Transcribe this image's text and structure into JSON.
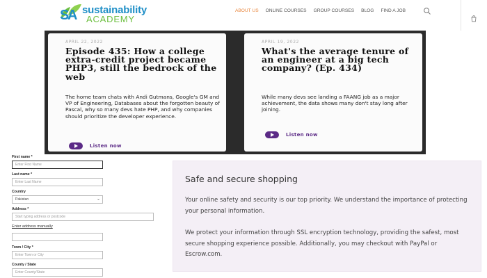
{
  "brand": {
    "line1": "sustainability",
    "line2": "ACADEMY",
    "colors": {
      "blue": "#1f8fc7",
      "green": "#6cbf3f"
    }
  },
  "nav": {
    "items": [
      {
        "label": "ABOUT US",
        "active": true
      },
      {
        "label": "ONLINE COURSES",
        "active": false
      },
      {
        "label": "GROUP COURSES",
        "active": false
      },
      {
        "label": "BLOG",
        "active": false
      },
      {
        "label": "FIND A JOB",
        "active": false
      }
    ],
    "accent": "#e8843a",
    "search_icon": "search-icon",
    "cart_icon": "cart-icon"
  },
  "podcast": {
    "cards": [
      {
        "date": "APRIL 22, 2022",
        "title": "Episode 435: How a college extra-credit project became PHP3, still the bedrock of the web",
        "desc": "The home team chats with Andi Gutmans, Google's GM and VP of Engineering, Databases about the forgotten beauty of Pascal, why so many devs hate PHP, and why companies should prioritize the developer experience.",
        "listen": "Listen now"
      },
      {
        "date": "APRIL 19, 2022",
        "title": "What's the average tenure of an engineer at a big tech company? (Ep. 434)",
        "desc": "While many devs see landing a FAANG job as a major achievement, the data shows many don't stay long after joining.",
        "listen": "Listen now"
      }
    ],
    "accent": "#5b2a86"
  },
  "form": {
    "first_name": {
      "label": "First name *",
      "placeholder": "Enter First Name"
    },
    "last_name": {
      "label": "Last name *",
      "placeholder": "Enter Last Name"
    },
    "country": {
      "label": "Country",
      "value": "Pakistan"
    },
    "address": {
      "label": "Address *",
      "placeholder": "Start typing address or postcode"
    },
    "manual_link": "Enter address manually",
    "town": {
      "label": "Town / City *",
      "placeholder": "Enter Town or City"
    },
    "county": {
      "label": "County / State",
      "placeholder": "Enter County/State"
    }
  },
  "secure": {
    "title": "Safe and secure shopping",
    "p1": "Your online safety and security is our top priority. We understand the importance of protecting your personal information.",
    "p2": "We protect your information through SSL encryption technology, providing the safest, most secure shopping experience possible. Additionally, you may checkout with PayPal or Escrow.com."
  }
}
